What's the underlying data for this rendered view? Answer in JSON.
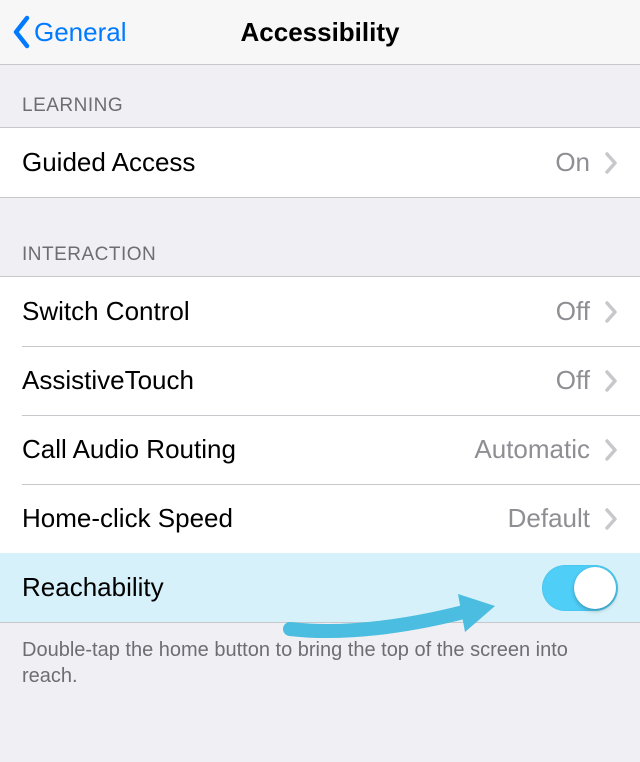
{
  "nav": {
    "back_label": "General",
    "title": "Accessibility"
  },
  "sections": [
    {
      "header": "LEARNING",
      "rows": [
        {
          "label": "Guided Access",
          "value": "On",
          "type": "disclosure"
        }
      ]
    },
    {
      "header": "INTERACTION",
      "rows": [
        {
          "label": "Switch Control",
          "value": "Off",
          "type": "disclosure"
        },
        {
          "label": "AssistiveTouch",
          "value": "Off",
          "type": "disclosure"
        },
        {
          "label": "Call Audio Routing",
          "value": "Automatic",
          "type": "disclosure"
        },
        {
          "label": "Home-click Speed",
          "value": "Default",
          "type": "disclosure"
        },
        {
          "label": "Reachability",
          "type": "toggle",
          "on": true,
          "highlighted": true
        }
      ],
      "footer": "Double-tap the home button to bring the top of the screen into reach."
    }
  ],
  "colors": {
    "tint": "#007AFF",
    "highlight": "#D6F1F9",
    "toggle_on": "#4FCFF8",
    "arrow": "#4BBDE0"
  }
}
